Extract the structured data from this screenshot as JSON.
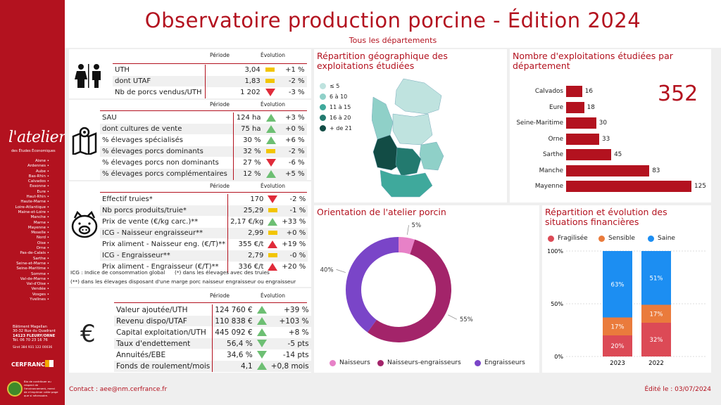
{
  "header": {
    "title": "Observatoire production porcine - Édition 2024",
    "subtitle": "Tous les départements"
  },
  "sidebar": {
    "logo": "l'atelier",
    "logo_sub": "des Études Économiques",
    "departments": [
      "Aisne",
      "Ardennes",
      "Aube",
      "Bas-Rhin",
      "Calvados",
      "Essonne",
      "Eure",
      "Haut-Rhin",
      "Haute-Marne",
      "Loire-Atlantique",
      "Maine-et-Loire",
      "Manche",
      "Marne",
      "Mayenne",
      "Moselle",
      "Nord",
      "Oise",
      "Orne",
      "Pas-de-Calais",
      "Sarthe",
      "Seine-et-Marne",
      "Seine-Maritime",
      "Somme",
      "Val-de-Marne",
      "Val-d'Oise",
      "Vendée",
      "Vosges",
      "Yvelines"
    ],
    "address": [
      "Bâtiment Magellan",
      "30-32 Rue du Quadrant",
      "14123 FLEURY/ORNE",
      "Tél. 06 70 23 16 76"
    ],
    "siret": "Siret 384 931 122 00036",
    "partner": "CERFRANCE",
    "bio_text": "Bio de contribuer au respect de l'environnement, merci de n'imprimer cette page que si nécessaire."
  },
  "col_headers": {
    "period": "Période",
    "evolution": "Évolution"
  },
  "section_labor": {
    "icon": "people-icon",
    "rows": [
      {
        "label": "UTH",
        "value": "3,04",
        "ind": "e",
        "evo": "+1 %"
      },
      {
        "label": "dont UTAF",
        "value": "1,83",
        "ind": "e",
        "evo": "-2 %"
      },
      {
        "label": "Nb de porcs vendus/UTH",
        "value": "1 202",
        "ind": "d",
        "evo": "-3 %"
      }
    ]
  },
  "section_land": {
    "icon": "map-icon",
    "rows": [
      {
        "label": "SAU",
        "value": "124 ha",
        "ind": "u",
        "evo": "+3 %"
      },
      {
        "label": "dont cultures de vente",
        "value": "75 ha",
        "ind": "u",
        "evo": "+0 %"
      },
      {
        "label": "% élevages spécialisés",
        "value": "30 %",
        "ind": "u",
        "evo": "+6 %"
      },
      {
        "label": "% élevages porcs dominants",
        "value": "32 %",
        "ind": "e",
        "evo": "-2 %"
      },
      {
        "label": "% élevages porcs non dominants",
        "value": "27 %",
        "ind": "d",
        "evo": "-6 %"
      },
      {
        "label": "% élevages porcs complémentaires",
        "value": "12 %",
        "ind": "u",
        "evo": "+5 %"
      }
    ]
  },
  "section_pig": {
    "icon": "pig-icon",
    "rows": [
      {
        "label": "Effectif truies*",
        "value": "170",
        "ind": "d",
        "evo": "-2 %"
      },
      {
        "label": "Nb porcs produits/truie*",
        "value": "25,29",
        "ind": "e",
        "evo": "-1 %"
      },
      {
        "label": "Prix de vente (€/kg carc.)**",
        "value": "2,17 €/kg",
        "ind": "u",
        "evo": "+33 %"
      },
      {
        "label": "ICG - Naisseur engraisseur**",
        "value": "2,99",
        "ind": "e",
        "evo": "+0 %"
      },
      {
        "label": "Prix aliment - Naisseur eng. (€/T)**",
        "value": "355 €/t",
        "ind": "r",
        "evo": "+19 %"
      },
      {
        "label": "ICG - Engraisseur**",
        "value": "2,79",
        "ind": "e",
        "evo": "-0 %"
      },
      {
        "label": "Prix aliment - Engraisseur (€/T)**",
        "value": "336 €/t",
        "ind": "r",
        "evo": "+20 %"
      }
    ],
    "notes": [
      "ICG : Indice de consommation global",
      "(*) dans les élevages avec des truies",
      "(**) dans les élevages disposant d'une marge porc naisseur engraisseur ou engraisseur"
    ]
  },
  "section_finance": {
    "icon": "euro-icon",
    "rows": [
      {
        "label": "Valeur ajoutée/UTH",
        "value": "124 760 €",
        "ind": "u",
        "evo": "+39 %"
      },
      {
        "label": "Revenu dispo/UTAF",
        "value": "110 838 €",
        "ind": "u",
        "evo": "+103 %"
      },
      {
        "label": "Capital exploitation/UTH",
        "value": "445 092 €",
        "ind": "u",
        "evo": "+8 %"
      },
      {
        "label": "Taux d'endettement",
        "value": "56,4 %",
        "ind": "g",
        "evo": "-5 pts"
      },
      {
        "label": "Annuités/EBE",
        "value": "34,6 %",
        "ind": "g",
        "evo": "-14 pts"
      },
      {
        "label": "Fonds de roulement/mois",
        "value": "4,1",
        "ind": "u",
        "evo": "+0,8 mois"
      }
    ]
  },
  "map_panel": {
    "title": "Répartition géographique des exploitations étudiées",
    "legend": [
      {
        "label": "≤ 5",
        "color": "#bfe3df"
      },
      {
        "label": "6 à 10",
        "color": "#8fd0c8"
      },
      {
        "label": "11 à 15",
        "color": "#3fa99c"
      },
      {
        "label": "16 à 20",
        "color": "#237a6f"
      },
      {
        "label": "+ de 21",
        "color": "#124c45"
      }
    ]
  },
  "count_panel": {
    "title": "Nombre d'exploitations étudiées par département",
    "total": "352"
  },
  "orientation_panel": {
    "title": "Orientation de l'atelier porcin"
  },
  "finance_panel": {
    "title": "Répartition et évolution des situations financières"
  },
  "footer": {
    "contact": "Contact : aee@nm.cerfrance.fr",
    "date": "Édité le : 03/07/2024"
  },
  "chart_data": [
    {
      "type": "bar",
      "orientation": "horizontal",
      "categories": [
        "Calvados",
        "Eure",
        "Seine-Maritime",
        "Orne",
        "Sarthe",
        "Manche",
        "Mayenne"
      ],
      "values": [
        16,
        18,
        30,
        33,
        45,
        83,
        125
      ],
      "color": "#b3121f"
    },
    {
      "type": "pie",
      "donut": true,
      "labels": [
        "Naisseurs",
        "Naisseurs-engraisseurs",
        "Engraisseurs"
      ],
      "values": [
        5,
        55,
        40
      ],
      "value_labels": [
        "5%",
        "55%",
        "40%"
      ],
      "colors": [
        "#e781c7",
        "#a3246a",
        "#7a45c8"
      ]
    },
    {
      "type": "bar",
      "stacked": true,
      "categories": [
        "2023",
        "2022"
      ],
      "series": [
        {
          "name": "Fragilisée",
          "values": [
            20,
            32
          ],
          "labels": [
            "20%",
            "32%"
          ],
          "color": "#dc4a56"
        },
        {
          "name": "Sensible",
          "values": [
            17,
            17
          ],
          "labels": [
            "17%",
            "17%"
          ],
          "color": "#ea7b3c"
        },
        {
          "name": "Saine",
          "values": [
            63,
            51
          ],
          "labels": [
            "63%",
            "51%"
          ],
          "color": "#1c8ef2"
        }
      ],
      "y_ticks": [
        "0%",
        "50%",
        "100%"
      ],
      "ylim": [
        0,
        100
      ]
    }
  ]
}
